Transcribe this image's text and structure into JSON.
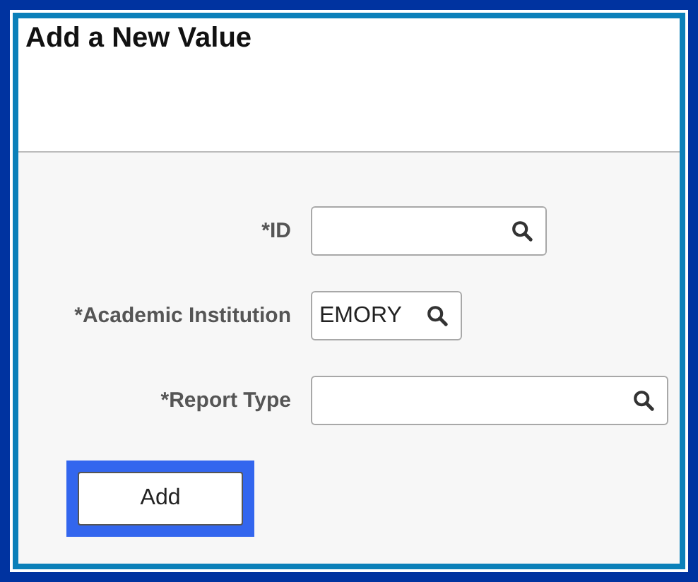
{
  "title": "Add a New Value",
  "fields": [
    {
      "label": "*ID"
    },
    {
      "label": "*Academic Institution",
      "value": "EMORY"
    },
    {
      "label": "*Report Type"
    }
  ],
  "button": {
    "label": "Add",
    "focused": true
  }
}
